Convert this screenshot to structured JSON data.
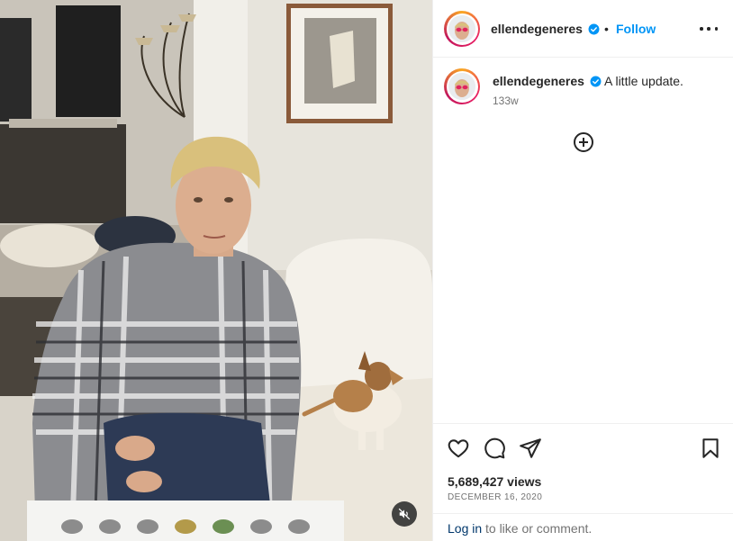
{
  "post": {
    "username": "ellendegeneres",
    "follow_label": "Follow",
    "separator": "•",
    "caption": "A little update.",
    "time_ago": "133w",
    "views": "5,689,427 views",
    "date": "DECEMBER 16, 2020"
  },
  "footer": {
    "login_label": "Log in",
    "rest_text": "to like or comment."
  },
  "colors": {
    "link_blue": "#0095f6",
    "verified_blue": "#0095f6",
    "text": "#262626",
    "muted": "#737373"
  },
  "icons": {
    "header_more": "more-options-icon",
    "like": "heart-icon",
    "comment": "comment-icon",
    "share": "share-icon",
    "save": "bookmark-icon",
    "add": "plus-circle-icon",
    "mute": "muted-speaker-icon"
  }
}
